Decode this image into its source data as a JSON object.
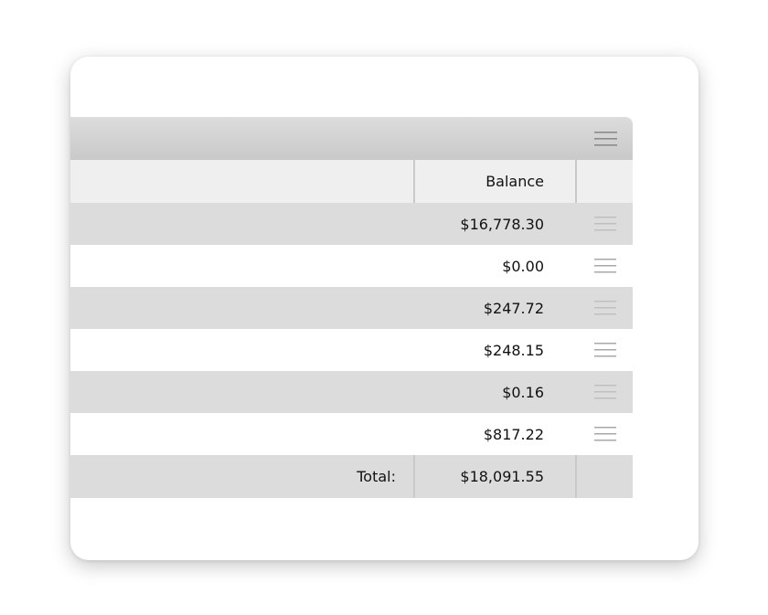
{
  "table": {
    "columns": {
      "balance": "Balance"
    },
    "rows": [
      {
        "balance": "$16,778.30"
      },
      {
        "balance": "$0.00"
      },
      {
        "balance": "$247.72"
      },
      {
        "balance": "$248.15"
      },
      {
        "balance": "$0.16"
      },
      {
        "balance": "$817.22"
      }
    ],
    "footer": {
      "total_label": "Total:",
      "total_value": "$18,091.55"
    }
  },
  "icons": {
    "toolbar_menu": "hamburger-menu-icon",
    "row_menu": "drag-handle-icon"
  },
  "colors": {
    "toolbar": "#d0d0d0",
    "header": "#efefef",
    "shaded_row": "#dcdcdc",
    "divider": "#c9c9c9"
  }
}
